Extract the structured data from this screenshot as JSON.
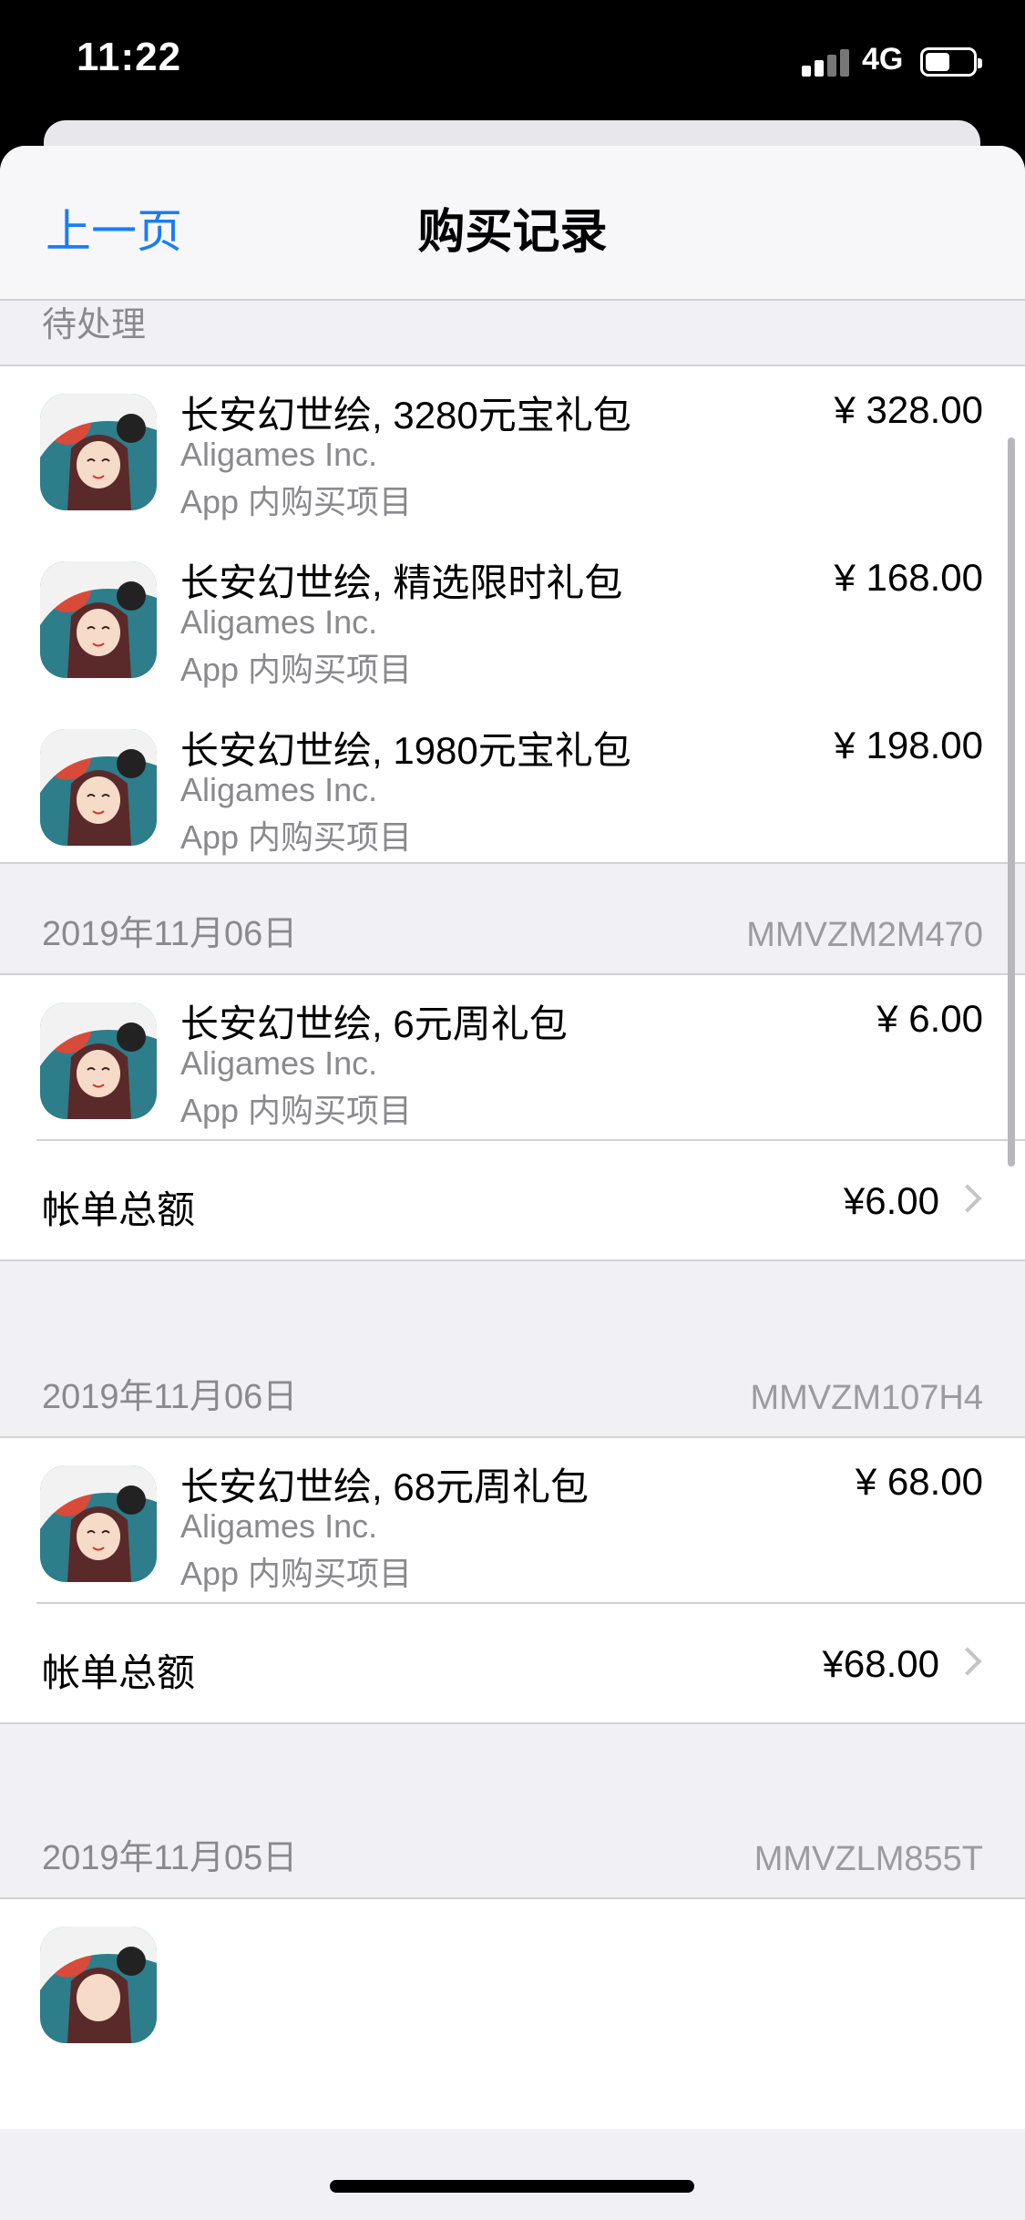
{
  "status_bar": {
    "time": "11:22",
    "network": "4G"
  },
  "nav": {
    "back_label": "上一页",
    "title": "购买记录"
  },
  "pending": {
    "header": "待处理",
    "items": [
      {
        "title": "长安幻世绘, 3280元宝礼包",
        "developer": "Aligames Inc.",
        "type": "App 内购买项目",
        "price": "¥ 328.00"
      },
      {
        "title": "长安幻世绘, 精选限时礼包",
        "developer": "Aligames Inc.",
        "type": "App 内购买项目",
        "price": "¥ 168.00"
      },
      {
        "title": "长安幻世绘, 1980元宝礼包",
        "developer": "Aligames Inc.",
        "type": "App 内购买项目",
        "price": "¥ 198.00"
      }
    ]
  },
  "orders": [
    {
      "date": "2019年11月06日",
      "order_id": "MMVZM2M470",
      "item": {
        "title": "长安幻世绘, 6元周礼包",
        "developer": "Aligames Inc.",
        "type": "App 内购买项目",
        "price": "¥ 6.00"
      },
      "total_label": "帐单总额",
      "total": "¥6.00"
    },
    {
      "date": "2019年11月06日",
      "order_id": "MMVZM107H4",
      "item": {
        "title": "长安幻世绘, 68元周礼包",
        "developer": "Aligames Inc.",
        "type": "App 内购买项目",
        "price": "¥ 68.00"
      },
      "total_label": "帐单总额",
      "total": "¥68.00"
    },
    {
      "date": "2019年11月05日",
      "order_id": "MMVZLM855T"
    }
  ],
  "icon": {
    "name": "game-app-icon"
  }
}
